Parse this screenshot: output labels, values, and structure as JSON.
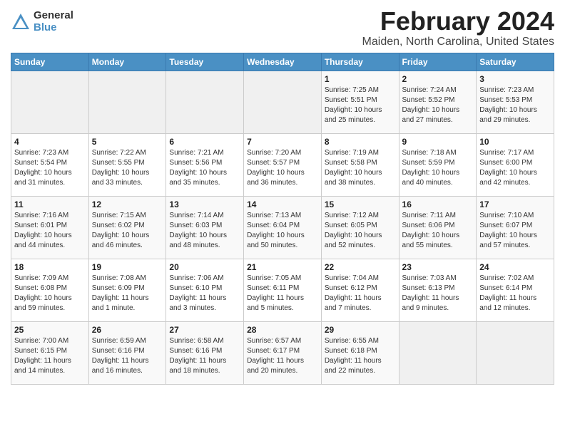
{
  "header": {
    "logo_general": "General",
    "logo_blue": "Blue",
    "title": "February 2024",
    "subtitle": "Maiden, North Carolina, United States"
  },
  "calendar": {
    "days_of_week": [
      "Sunday",
      "Monday",
      "Tuesday",
      "Wednesday",
      "Thursday",
      "Friday",
      "Saturday"
    ],
    "weeks": [
      [
        {
          "day": "",
          "content": ""
        },
        {
          "day": "",
          "content": ""
        },
        {
          "day": "",
          "content": ""
        },
        {
          "day": "",
          "content": ""
        },
        {
          "day": "1",
          "content": "Sunrise: 7:25 AM\nSunset: 5:51 PM\nDaylight: 10 hours\nand 25 minutes."
        },
        {
          "day": "2",
          "content": "Sunrise: 7:24 AM\nSunset: 5:52 PM\nDaylight: 10 hours\nand 27 minutes."
        },
        {
          "day": "3",
          "content": "Sunrise: 7:23 AM\nSunset: 5:53 PM\nDaylight: 10 hours\nand 29 minutes."
        }
      ],
      [
        {
          "day": "4",
          "content": "Sunrise: 7:23 AM\nSunset: 5:54 PM\nDaylight: 10 hours\nand 31 minutes."
        },
        {
          "day": "5",
          "content": "Sunrise: 7:22 AM\nSunset: 5:55 PM\nDaylight: 10 hours\nand 33 minutes."
        },
        {
          "day": "6",
          "content": "Sunrise: 7:21 AM\nSunset: 5:56 PM\nDaylight: 10 hours\nand 35 minutes."
        },
        {
          "day": "7",
          "content": "Sunrise: 7:20 AM\nSunset: 5:57 PM\nDaylight: 10 hours\nand 36 minutes."
        },
        {
          "day": "8",
          "content": "Sunrise: 7:19 AM\nSunset: 5:58 PM\nDaylight: 10 hours\nand 38 minutes."
        },
        {
          "day": "9",
          "content": "Sunrise: 7:18 AM\nSunset: 5:59 PM\nDaylight: 10 hours\nand 40 minutes."
        },
        {
          "day": "10",
          "content": "Sunrise: 7:17 AM\nSunset: 6:00 PM\nDaylight: 10 hours\nand 42 minutes."
        }
      ],
      [
        {
          "day": "11",
          "content": "Sunrise: 7:16 AM\nSunset: 6:01 PM\nDaylight: 10 hours\nand 44 minutes."
        },
        {
          "day": "12",
          "content": "Sunrise: 7:15 AM\nSunset: 6:02 PM\nDaylight: 10 hours\nand 46 minutes."
        },
        {
          "day": "13",
          "content": "Sunrise: 7:14 AM\nSunset: 6:03 PM\nDaylight: 10 hours\nand 48 minutes."
        },
        {
          "day": "14",
          "content": "Sunrise: 7:13 AM\nSunset: 6:04 PM\nDaylight: 10 hours\nand 50 minutes."
        },
        {
          "day": "15",
          "content": "Sunrise: 7:12 AM\nSunset: 6:05 PM\nDaylight: 10 hours\nand 52 minutes."
        },
        {
          "day": "16",
          "content": "Sunrise: 7:11 AM\nSunset: 6:06 PM\nDaylight: 10 hours\nand 55 minutes."
        },
        {
          "day": "17",
          "content": "Sunrise: 7:10 AM\nSunset: 6:07 PM\nDaylight: 10 hours\nand 57 minutes."
        }
      ],
      [
        {
          "day": "18",
          "content": "Sunrise: 7:09 AM\nSunset: 6:08 PM\nDaylight: 10 hours\nand 59 minutes."
        },
        {
          "day": "19",
          "content": "Sunrise: 7:08 AM\nSunset: 6:09 PM\nDaylight: 11 hours\nand 1 minute."
        },
        {
          "day": "20",
          "content": "Sunrise: 7:06 AM\nSunset: 6:10 PM\nDaylight: 11 hours\nand 3 minutes."
        },
        {
          "day": "21",
          "content": "Sunrise: 7:05 AM\nSunset: 6:11 PM\nDaylight: 11 hours\nand 5 minutes."
        },
        {
          "day": "22",
          "content": "Sunrise: 7:04 AM\nSunset: 6:12 PM\nDaylight: 11 hours\nand 7 minutes."
        },
        {
          "day": "23",
          "content": "Sunrise: 7:03 AM\nSunset: 6:13 PM\nDaylight: 11 hours\nand 9 minutes."
        },
        {
          "day": "24",
          "content": "Sunrise: 7:02 AM\nSunset: 6:14 PM\nDaylight: 11 hours\nand 12 minutes."
        }
      ],
      [
        {
          "day": "25",
          "content": "Sunrise: 7:00 AM\nSunset: 6:15 PM\nDaylight: 11 hours\nand 14 minutes."
        },
        {
          "day": "26",
          "content": "Sunrise: 6:59 AM\nSunset: 6:16 PM\nDaylight: 11 hours\nand 16 minutes."
        },
        {
          "day": "27",
          "content": "Sunrise: 6:58 AM\nSunset: 6:16 PM\nDaylight: 11 hours\nand 18 minutes."
        },
        {
          "day": "28",
          "content": "Sunrise: 6:57 AM\nSunset: 6:17 PM\nDaylight: 11 hours\nand 20 minutes."
        },
        {
          "day": "29",
          "content": "Sunrise: 6:55 AM\nSunset: 6:18 PM\nDaylight: 11 hours\nand 22 minutes."
        },
        {
          "day": "",
          "content": ""
        },
        {
          "day": "",
          "content": ""
        }
      ]
    ]
  }
}
